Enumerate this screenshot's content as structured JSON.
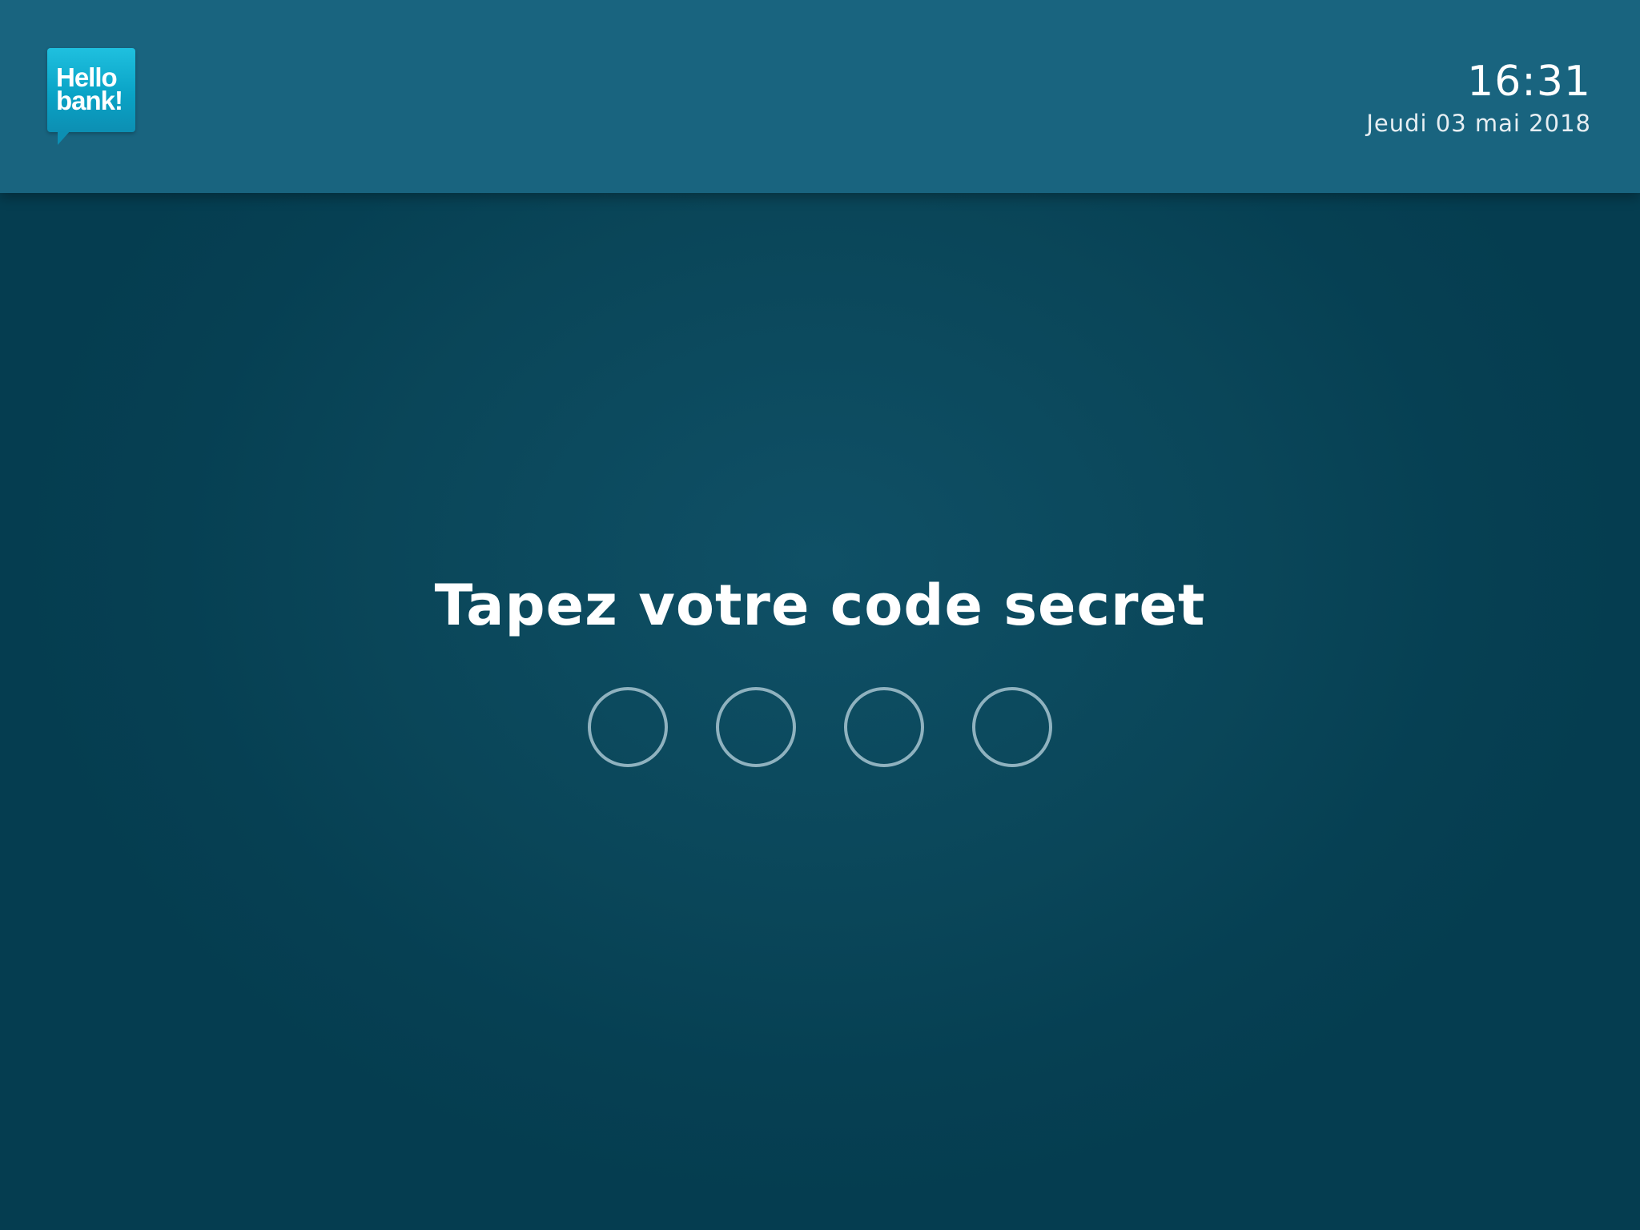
{
  "header": {
    "logo": {
      "line1": "Hello",
      "line2": "bank!",
      "color": "#13b3d6"
    },
    "time": "16:31",
    "date": "Jeudi 03 mai 2018"
  },
  "main": {
    "prompt": "Tapez votre code secret",
    "pin": {
      "length": 4,
      "entered": 0
    }
  },
  "colors": {
    "header_bg": "#19647f",
    "body_bg": "#053d50",
    "pin_dot_border": "#8fb2bf"
  }
}
